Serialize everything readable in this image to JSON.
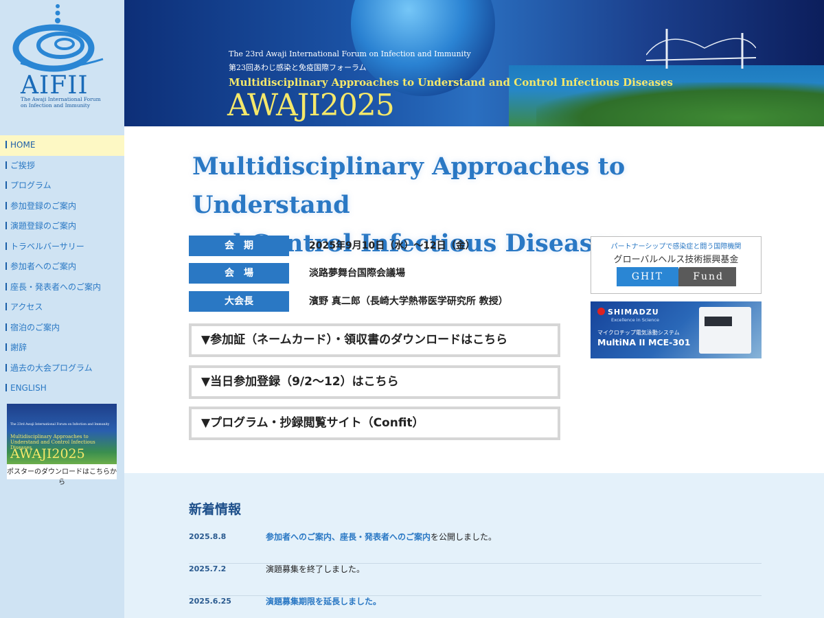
{
  "sidebar": {
    "logo": {
      "abbr": "AIFII",
      "sub_line1": "The Awaji International Forum",
      "sub_line2": "on Infection and Immunity"
    },
    "nav": [
      {
        "label": "HOME",
        "active": true
      },
      {
        "label": "ご挨拶"
      },
      {
        "label": "プログラム"
      },
      {
        "label": "参加登録のご案内"
      },
      {
        "label": "演題登録のご案内"
      },
      {
        "label": "トラベルバーサリー"
      },
      {
        "label": "参加者へのご案内"
      },
      {
        "label": "座長・発表者へのご案内"
      },
      {
        "label": "アクセス"
      },
      {
        "label": "宿泊のご案内"
      },
      {
        "label": "謝辞"
      },
      {
        "label": "過去の大会プログラム"
      },
      {
        "label": "ENGLISH"
      }
    ],
    "poster": {
      "line1": "The 23rd Awaji International Forum on Infection and Immunity",
      "line2": "Multidisciplinary Approaches to Understand and Control Infectious Diseases",
      "line3": "AWAJI2025",
      "caption": "ポスターのダウンロードはこちらから"
    }
  },
  "banner": {
    "line1": "The 23rd Awaji International Forum on Infection and Immunity",
    "line2": "第23回あわじ感染と免疫国際フォーラム",
    "line3": "Multidisciplinary Approaches to Understand and Control Infectious Diseases",
    "line4": "AWAJI2025"
  },
  "main": {
    "title_line1": "Multidisciplinary Approaches to Understand",
    "title_line2": "and Control Infectious Diseases",
    "info": [
      {
        "label": "会　期",
        "value": "2025年9月10日（水）～12日（金）"
      },
      {
        "label": "会　場",
        "value": "淡路夢舞台国際会議場"
      },
      {
        "label": "大会長",
        "value": "濱野 真二郎（長崎大学熱帯医学研究所 教授）"
      }
    ],
    "links": [
      "▼参加証（ネームカード）・領収書のダウンロードはこちら",
      "▼当日参加登録（9/2～12）はこちら",
      "▼プログラム・抄録閲覧サイト（Confit）"
    ]
  },
  "sponsors": {
    "ghit": {
      "line1": "パートナーシップで感染症と闘う国際機関",
      "line2": "グローバルヘルス技術振興基金",
      "left": "GHIT",
      "right": "Fund"
    },
    "shimadzu": {
      "brand": "SHIMADZU",
      "tagline": "Excellence in Science",
      "jp": "マイクロチップ電気泳動システム",
      "product": "MultiNA II MCE-301"
    }
  },
  "news": {
    "title": "新着情報",
    "items": [
      {
        "date": "2025.8.8",
        "link_text": "参加者へのご案内、座長・発表者へのご案内",
        "text": "を公開しました。"
      },
      {
        "date": "2025.7.2",
        "link_text": "",
        "text": "演題募集を終了しました。"
      },
      {
        "date": "2025.6.25",
        "link_text": "演題募集期限を延長しました。",
        "text": ""
      }
    ]
  },
  "colors": {
    "accent": "#2a78c4",
    "sidebar_bg": "#cfe3f3",
    "active_bg": "#fdf8c4",
    "news_bg": "#e4f1fa"
  }
}
